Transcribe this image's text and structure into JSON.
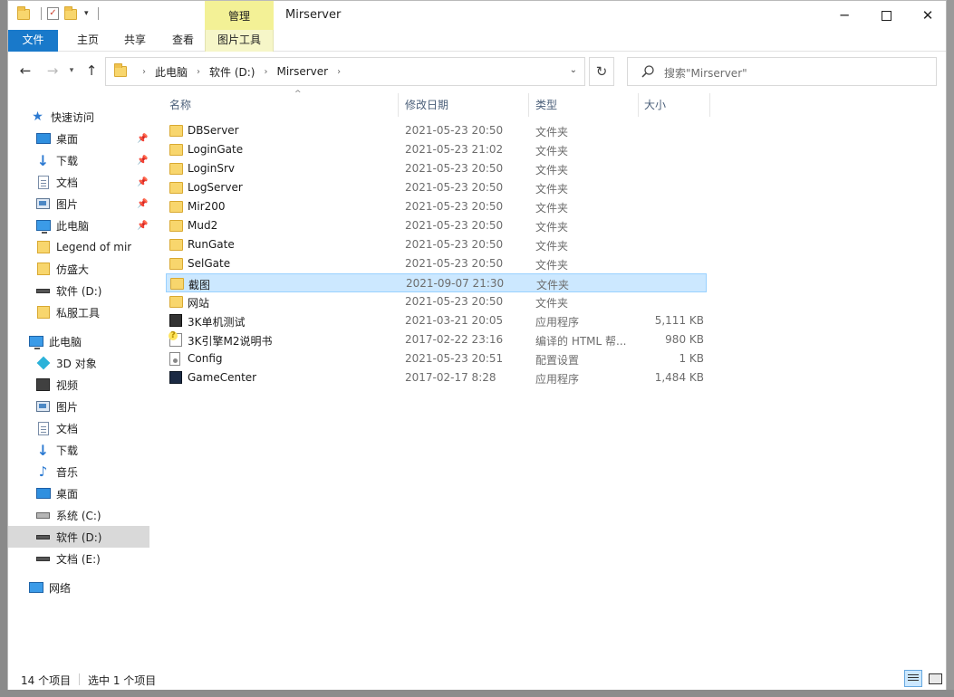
{
  "window": {
    "title": "Mirserver",
    "context_tab_group": "管理"
  },
  "ribbon": {
    "tabs": [
      "文件",
      "主页",
      "共享",
      "查看",
      "图片工具"
    ]
  },
  "address": {
    "crumbs": [
      "此电脑",
      "软件 (D:)",
      "Mirserver"
    ]
  },
  "search": {
    "placeholder": "搜索\"Mirserver\""
  },
  "sidebar": {
    "quick_access": "快速访问",
    "quick_items": [
      {
        "label": "桌面",
        "icon": "desktop-icon",
        "pinned": true
      },
      {
        "label": "下载",
        "icon": "download-icon",
        "pinned": true
      },
      {
        "label": "文档",
        "icon": "document-icon",
        "pinned": true
      },
      {
        "label": "图片",
        "icon": "picture-icon",
        "pinned": true
      },
      {
        "label": "此电脑",
        "icon": "computer-icon",
        "pinned": true
      },
      {
        "label": "Legend of mir",
        "icon": "folder-icon"
      },
      {
        "label": "仿盛大",
        "icon": "folder-icon"
      },
      {
        "label": "软件 (D:)",
        "icon": "drive-icon"
      },
      {
        "label": "私服工具",
        "icon": "folder-icon"
      }
    ],
    "this_pc": "此电脑",
    "pc_items": [
      {
        "label": "3D 对象",
        "icon": "3d-objects-icon"
      },
      {
        "label": "视频",
        "icon": "video-icon"
      },
      {
        "label": "图片",
        "icon": "picture-icon"
      },
      {
        "label": "文档",
        "icon": "document-icon"
      },
      {
        "label": "下载",
        "icon": "download-icon"
      },
      {
        "label": "音乐",
        "icon": "music-icon"
      },
      {
        "label": "桌面",
        "icon": "desktop-icon"
      },
      {
        "label": "系统 (C:)",
        "icon": "system-drive-icon"
      },
      {
        "label": "软件 (D:)",
        "icon": "drive-icon",
        "selected": true
      },
      {
        "label": "文档 (E:)",
        "icon": "drive-icon"
      }
    ],
    "network": "网络"
  },
  "columns": {
    "name": "名称",
    "date": "修改日期",
    "type": "类型",
    "size": "大小"
  },
  "files": [
    {
      "name": "DBServer",
      "date": "2021-05-23 20:50",
      "type": "文件夹",
      "size": "",
      "icon": "folder-icon"
    },
    {
      "name": "LoginGate",
      "date": "2021-05-23 21:02",
      "type": "文件夹",
      "size": "",
      "icon": "folder-icon"
    },
    {
      "name": "LoginSrv",
      "date": "2021-05-23 20:50",
      "type": "文件夹",
      "size": "",
      "icon": "folder-icon"
    },
    {
      "name": "LogServer",
      "date": "2021-05-23 20:50",
      "type": "文件夹",
      "size": "",
      "icon": "folder-icon"
    },
    {
      "name": "Mir200",
      "date": "2021-05-23 20:50",
      "type": "文件夹",
      "size": "",
      "icon": "folder-icon"
    },
    {
      "name": "Mud2",
      "date": "2021-05-23 20:50",
      "type": "文件夹",
      "size": "",
      "icon": "folder-icon"
    },
    {
      "name": "RunGate",
      "date": "2021-05-23 20:50",
      "type": "文件夹",
      "size": "",
      "icon": "folder-icon"
    },
    {
      "name": "SelGate",
      "date": "2021-05-23 20:50",
      "type": "文件夹",
      "size": "",
      "icon": "folder-icon"
    },
    {
      "name": "截图",
      "date": "2021-09-07 21:30",
      "type": "文件夹",
      "size": "",
      "icon": "folder-icon",
      "selected": true
    },
    {
      "name": "网站",
      "date": "2021-05-23 20:50",
      "type": "文件夹",
      "size": "",
      "icon": "folder-icon"
    },
    {
      "name": "3K单机测试",
      "date": "2021-03-21 20:05",
      "type": "应用程序",
      "size": "5,111 KB",
      "icon": "application-icon"
    },
    {
      "name": "3K引擎M2说明书",
      "date": "2017-02-22 23:16",
      "type": "编译的 HTML 帮...",
      "size": "980 KB",
      "icon": "help-file-icon"
    },
    {
      "name": "Config",
      "date": "2021-05-23 20:51",
      "type": "配置设置",
      "size": "1 KB",
      "icon": "config-file-icon"
    },
    {
      "name": "GameCenter",
      "date": "2017-02-17 8:28",
      "type": "应用程序",
      "size": "1,484 KB",
      "icon": "game-app-icon"
    }
  ],
  "status": {
    "item_count": "14 个项目",
    "selected_count": "选中 1 个项目"
  }
}
